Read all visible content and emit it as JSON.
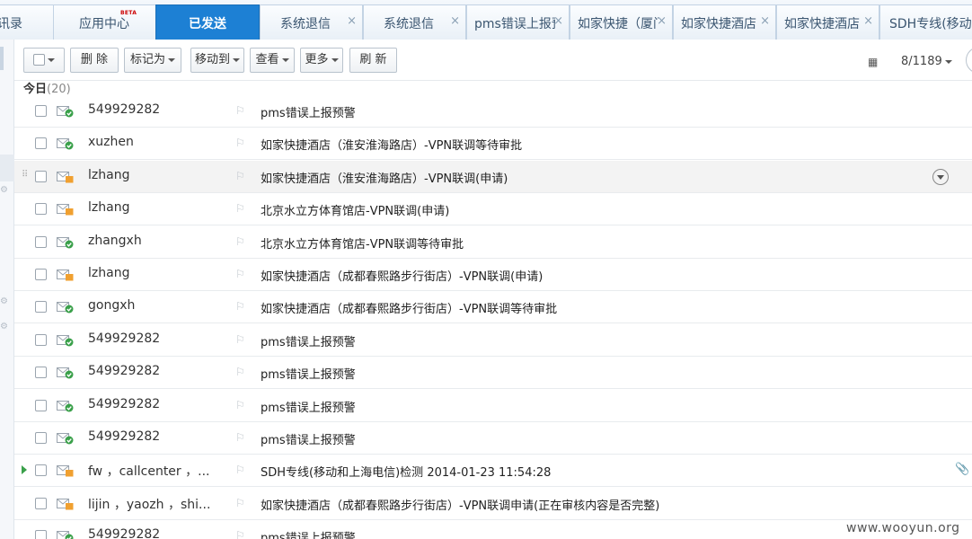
{
  "tabs": [
    {
      "label": "讯录",
      "closable": false,
      "active": false
    },
    {
      "label": "应用中心",
      "badge": "BETA",
      "closable": false,
      "active": false
    },
    {
      "label": "已发送",
      "closable": false,
      "active": true
    },
    {
      "label": "系统退信",
      "closable": true,
      "active": false
    },
    {
      "label": "系统退信",
      "closable": true,
      "active": false
    },
    {
      "label": "pms错误上报预警",
      "closable": true,
      "active": false
    },
    {
      "label": "如家快捷（厦门",
      "closable": true,
      "active": false
    },
    {
      "label": "如家快捷酒店",
      "closable": true,
      "active": false
    },
    {
      "label": "如家快捷酒店",
      "closable": true,
      "active": false
    },
    {
      "label": "SDH专线(移动和",
      "closable": true,
      "active": false
    }
  ],
  "tab_close_glyph": "×",
  "toolbar": {
    "delete_label": "删 除",
    "mark_label": "标记为",
    "move_label": "移动到",
    "view_label": "查看",
    "more_label": "更多",
    "refresh_label": "刷 新",
    "page_indicator": "8/1189"
  },
  "group": {
    "label": "今日",
    "count": "(20)"
  },
  "messages": [
    {
      "sender": "549929282",
      "subject": "pms错误上报预警",
      "status": "sent"
    },
    {
      "sender": "xuzhen",
      "subject": "如家快捷酒店（淮安淮海路店）-VPN联调等待审批",
      "status": "sent"
    },
    {
      "sender": "lzhang",
      "subject": "如家快捷酒店（淮安淮海路店）-VPN联调(申请)",
      "status": "pending"
    },
    {
      "sender": "lzhang",
      "subject": "北京水立方体育馆店-VPN联调(申请)",
      "status": "pending"
    },
    {
      "sender": "zhangxh",
      "subject": "北京水立方体育馆店-VPN联调等待审批",
      "status": "sent"
    },
    {
      "sender": "lzhang",
      "subject": "如家快捷酒店（成都春熙路步行街店）-VPN联调(申请)",
      "status": "pending"
    },
    {
      "sender": "gongxh",
      "subject": "如家快捷酒店（成都春熙路步行街店）-VPN联调等待审批",
      "status": "sent"
    },
    {
      "sender": "549929282",
      "subject": "pms错误上报预警",
      "status": "sent"
    },
    {
      "sender": "549929282",
      "subject": "pms错误上报预警",
      "status": "sent"
    },
    {
      "sender": "549929282",
      "subject": "pms错误上报预警",
      "status": "sent"
    },
    {
      "sender": "549929282",
      "subject": "pms错误上报预警",
      "status": "sent"
    },
    {
      "sender": "fw ，callcenter ，...",
      "subject": "SDH专线(移动和上海电信)检测 2014-01-23 11:54:28",
      "status": "pending"
    },
    {
      "sender": "lijin ，yaozh ，shi...",
      "subject": "如家快捷酒店（成都春熙路步行街店）-VPN联调申请(正在审核内容是否完整)",
      "status": "pending"
    },
    {
      "sender": "549929282",
      "subject": "pms错误上报预警",
      "status": "sent"
    }
  ],
  "watermark": "www.wooyun.org",
  "colors": {
    "accent": "#1d80d4",
    "sent": "#3aa04a",
    "pending": "#f0a030"
  }
}
